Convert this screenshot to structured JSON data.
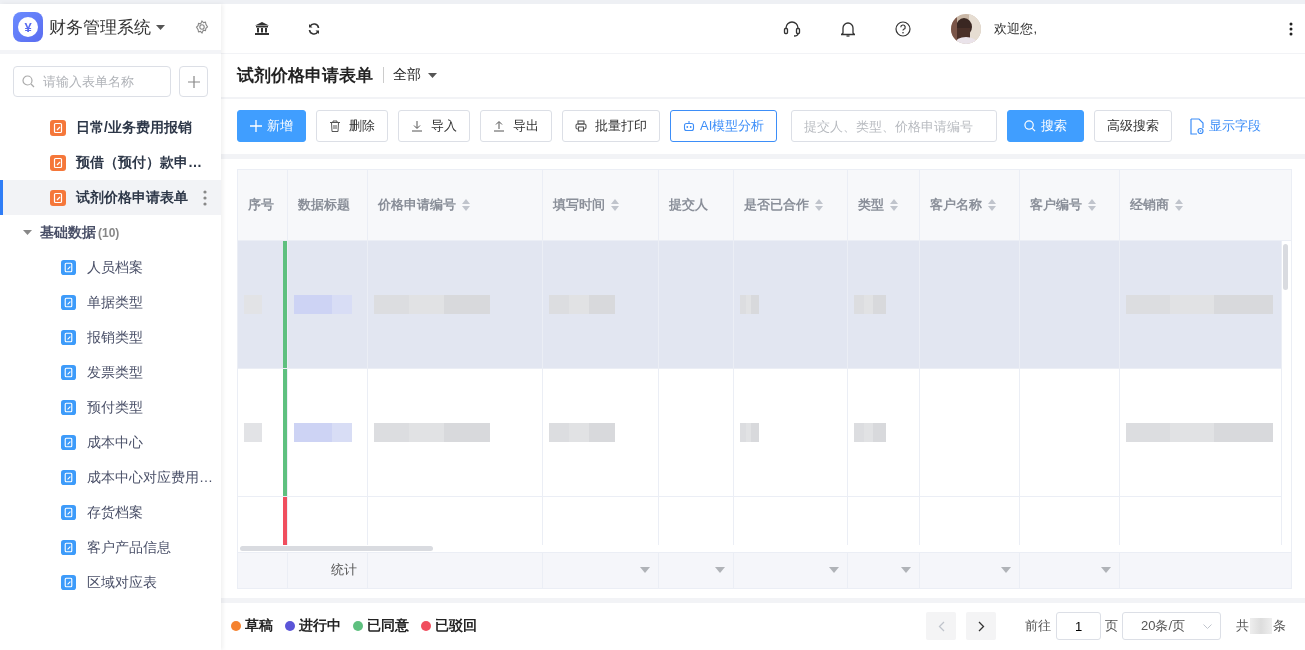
{
  "app": {
    "logo_glyph": "¥",
    "title": "财务管理系统"
  },
  "sidebar": {
    "search_placeholder": "请输入表单名称",
    "forms": [
      {
        "label": "日常/业务费用报销",
        "selected": false
      },
      {
        "label": "预借（预付）款申…",
        "selected": false
      },
      {
        "label": "试剂价格申请表单",
        "selected": true
      }
    ],
    "groups": [
      {
        "label": "基础数据",
        "count": "(10)",
        "expanded": true,
        "children": [
          {
            "label": "人员档案"
          },
          {
            "label": "单据类型"
          },
          {
            "label": "报销类型"
          },
          {
            "label": "发票类型"
          },
          {
            "label": "预付类型"
          },
          {
            "label": "成本中心"
          },
          {
            "label": "成本中心对应费用…"
          },
          {
            "label": "存货档案"
          },
          {
            "label": "客户产品信息"
          },
          {
            "label": "区域对应表"
          }
        ]
      }
    ]
  },
  "header": {
    "greeting": "欢迎您,"
  },
  "page": {
    "title": "试剂价格申请表单",
    "filter": "全部"
  },
  "toolbar": {
    "buttons": [
      {
        "label": "新增",
        "kind": "add"
      },
      {
        "label": "删除",
        "kind": "delete"
      },
      {
        "label": "导入",
        "kind": "import"
      },
      {
        "label": "导出",
        "kind": "export"
      },
      {
        "label": "批量打印",
        "kind": "print"
      },
      {
        "label": "AI模型分析",
        "kind": "ai"
      }
    ],
    "search": {
      "placeholder": "提交人、类型、价格申请编号"
    },
    "search_button": "搜索",
    "advanced_button": "高级搜索",
    "fields_link": "显示字段"
  },
  "table": {
    "columns": [
      {
        "label": "序号",
        "sortable": false
      },
      {
        "label": "数据标题",
        "sortable": false
      },
      {
        "label": "价格申请编号",
        "sortable": true
      },
      {
        "label": "填写时间",
        "sortable": true
      },
      {
        "label": "提交人",
        "sortable": false
      },
      {
        "label": "是否已合作",
        "sortable": true
      },
      {
        "label": "类型",
        "sortable": true
      },
      {
        "label": "客户名称",
        "sortable": true
      },
      {
        "label": "客户编号",
        "sortable": true
      },
      {
        "label": "经销商",
        "sortable": true
      }
    ],
    "rows": [
      {
        "highlighted": true,
        "color": "#5ec07f",
        "cells": [
          {
            "kind": "blur-faint"
          },
          {
            "kind": "blur-blue"
          },
          {
            "kind": "blur"
          },
          {
            "kind": "blur"
          },
          {
            "kind": "empty"
          },
          {
            "kind": "blur"
          },
          {
            "kind": "blur"
          },
          {
            "kind": "empty"
          },
          {
            "kind": "empty"
          },
          {
            "kind": "blur"
          }
        ]
      },
      {
        "highlighted": false,
        "color": "#5ec07f",
        "cells": [
          {
            "kind": "blur-faint"
          },
          {
            "kind": "blur-blue"
          },
          {
            "kind": "blur"
          },
          {
            "kind": "blur"
          },
          {
            "kind": "empty"
          },
          {
            "kind": "blur"
          },
          {
            "kind": "blur"
          },
          {
            "kind": "empty"
          },
          {
            "kind": "empty"
          },
          {
            "kind": "blur"
          }
        ]
      },
      {
        "highlighted": false,
        "color": "#f04e5e",
        "cells": [
          {
            "kind": "empty"
          },
          {
            "kind": "empty"
          },
          {
            "kind": "empty"
          },
          {
            "kind": "empty"
          },
          {
            "kind": "empty"
          },
          {
            "kind": "empty"
          },
          {
            "kind": "empty"
          },
          {
            "kind": "empty"
          },
          {
            "kind": "empty"
          },
          {
            "kind": "empty"
          }
        ]
      }
    ],
    "summary": [
      {
        "kind": "blank"
      },
      {
        "kind": "label",
        "text": "统计"
      },
      {
        "kind": "blank"
      },
      {
        "kind": "filter"
      },
      {
        "kind": "filter"
      },
      {
        "kind": "filter"
      },
      {
        "kind": "filter"
      },
      {
        "kind": "filter"
      },
      {
        "kind": "filter"
      },
      {
        "kind": "blank"
      }
    ]
  },
  "legend": [
    {
      "label": "草稿",
      "color": "#f5822f"
    },
    {
      "label": "进行中",
      "color": "#5b55d8"
    },
    {
      "label": "已同意",
      "color": "#5ec07f"
    },
    {
      "label": "已驳回",
      "color": "#f04e5e"
    }
  ],
  "pagination": {
    "prev_disabled": true,
    "goto_label": "前往",
    "page": "1",
    "page_suffix": "页",
    "page_size": "20条/页",
    "total_prefix": "共",
    "total_redacted": true,
    "total_suffix": "条"
  }
}
